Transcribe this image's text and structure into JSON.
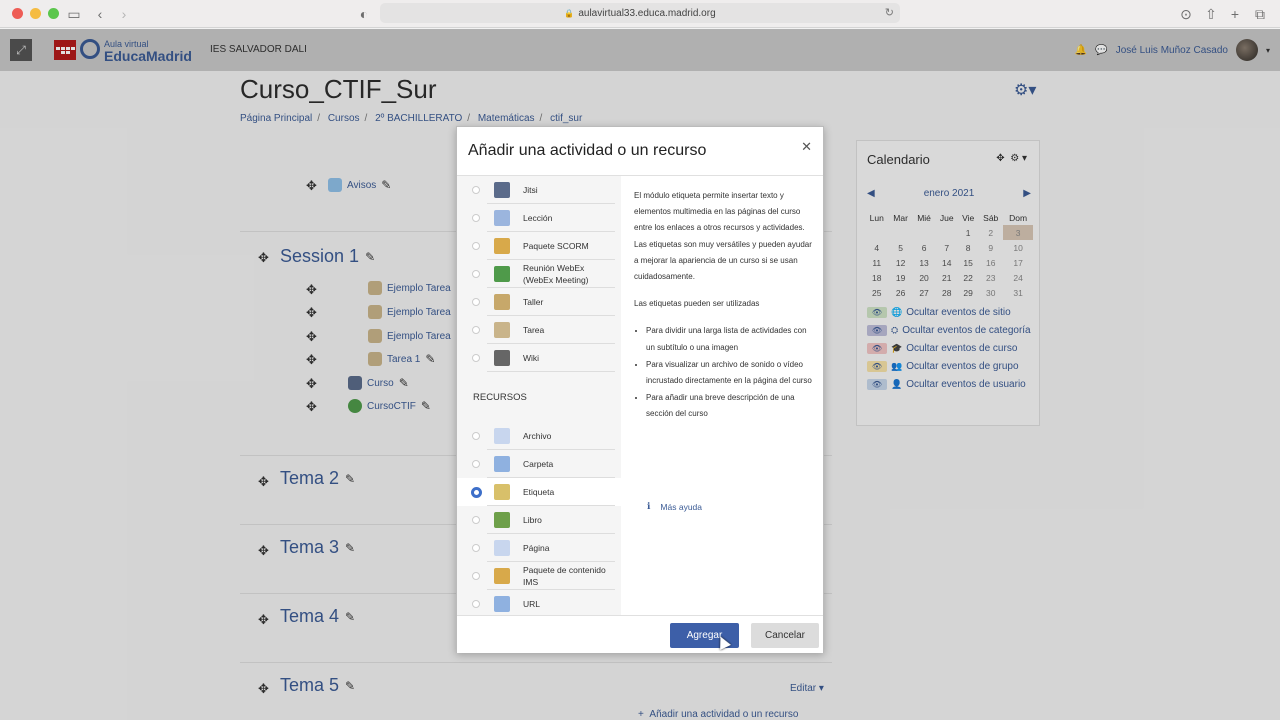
{
  "browser": {
    "url": "aulavirtual33.educa.madrid.org"
  },
  "navbar": {
    "logo_top": "Aula virtual",
    "logo_main": "EducaMadrid",
    "site_name": "IES SALVADOR DALI",
    "user_name": "José Luis Muñoz Casado"
  },
  "page": {
    "title": "Curso_CTIF_Sur",
    "breadcrumb": [
      "Página Principal",
      "Cursos",
      "2º BACHILLERATO",
      "Matemáticas",
      "ctif_sur"
    ]
  },
  "course": {
    "avisos": "Avisos",
    "session1": {
      "title": "Session 1",
      "activities": [
        "Ejemplo Tarea",
        "Ejemplo Tarea",
        "Ejemplo Tarea",
        "Tarea 1",
        "Curso",
        "CursoCTIF"
      ]
    },
    "sections": [
      "Tema 2",
      "Tema 3",
      "Tema 4",
      "Tema 5"
    ],
    "edit_label": "Editar",
    "add_activity": "Añadir una actividad o un recurso"
  },
  "calendar": {
    "title": "Calendario",
    "month": "enero 2021",
    "weekdays": [
      "Lun",
      "Mar",
      "Mié",
      "Jue",
      "Vie",
      "Sáb",
      "Dom"
    ],
    "weeks": [
      [
        "",
        "",
        "",
        "",
        "1",
        "2",
        "3"
      ],
      [
        "4",
        "5",
        "6",
        "7",
        "8",
        "9",
        "10"
      ],
      [
        "11",
        "12",
        "13",
        "14",
        "15",
        "16",
        "17"
      ],
      [
        "18",
        "19",
        "20",
        "21",
        "22",
        "23",
        "24"
      ],
      [
        "25",
        "26",
        "27",
        "28",
        "29",
        "30",
        "31"
      ]
    ],
    "today": "3",
    "filters": [
      {
        "label": "Ocultar eventos de sitio",
        "color": "#cfe3c5",
        "icon": "globe-icon"
      },
      {
        "label": "Ocultar eventos de categoría",
        "color": "#bdbdd9",
        "icon": "cubes-icon"
      },
      {
        "label": "Ocultar eventos de curso",
        "color": "#f1c4c4",
        "icon": "graduation-cap-icon"
      },
      {
        "label": "Ocultar eventos de grupo",
        "color": "#f6e2a8",
        "icon": "users-icon"
      },
      {
        "label": "Ocultar eventos de usuario",
        "color": "#c7d7ea",
        "icon": "user-icon"
      }
    ]
  },
  "modal": {
    "title": "Añadir una actividad o un recurso",
    "activities": [
      {
        "label": "Jitsi",
        "icon": "jitsi-icon",
        "color": "#5b6b8a"
      },
      {
        "label": "Lección",
        "icon": "lesson-icon",
        "color": "#9bb5de"
      },
      {
        "label": "Paquete SCORM",
        "icon": "scorm-icon",
        "color": "#d8a94a"
      },
      {
        "label": "Reunión WebEx (WebEx Meeting)",
        "icon": "webex-icon",
        "color": "#4f9a4a"
      },
      {
        "label": "Taller",
        "icon": "workshop-icon",
        "color": "#c7a86a"
      },
      {
        "label": "Tarea",
        "icon": "assignment-icon",
        "color": "#c9b48a"
      },
      {
        "label": "Wiki",
        "icon": "wiki-icon",
        "color": "#666666"
      }
    ],
    "resources_header": "RECURSOS",
    "resources": [
      {
        "label": "Archivo",
        "icon": "file-icon",
        "color": "#c8d6ee"
      },
      {
        "label": "Carpeta",
        "icon": "folder-icon",
        "color": "#8fb1e0"
      },
      {
        "label": "Etiqueta",
        "icon": "label-tag-icon",
        "color": "#d8c06a"
      },
      {
        "label": "Libro",
        "icon": "book-icon",
        "color": "#6ea04a"
      },
      {
        "label": "Página",
        "icon": "page-icon",
        "color": "#c8d6ee"
      },
      {
        "label": "Paquete de contenido IMS",
        "icon": "ims-package-icon",
        "color": "#d8a94a"
      },
      {
        "label": "URL",
        "icon": "url-icon",
        "color": "#8fb1e0"
      }
    ],
    "selected": "Etiqueta",
    "description": {
      "p1": "El módulo etiqueta permite insertar texto y elementos multimedia en las páginas del curso entre los enlaces a otros recursos y actividades. Las etiquetas son muy versátiles y pueden ayudar a mejorar la apariencia de un curso si se usan cuidadosamente.",
      "p2": "Las etiquetas pueden ser utilizadas",
      "bullets": [
        "Para dividir una larga lista de actividades con un subtítulo o una imagen",
        "Para visualizar un archivo de sonido o vídeo incrustado directamente en la página del curso",
        "Para añadir una breve descripción de una sección del curso"
      ]
    },
    "more_help": "Más ayuda",
    "add_button": "Agregar",
    "cancel_button": "Cancelar"
  }
}
